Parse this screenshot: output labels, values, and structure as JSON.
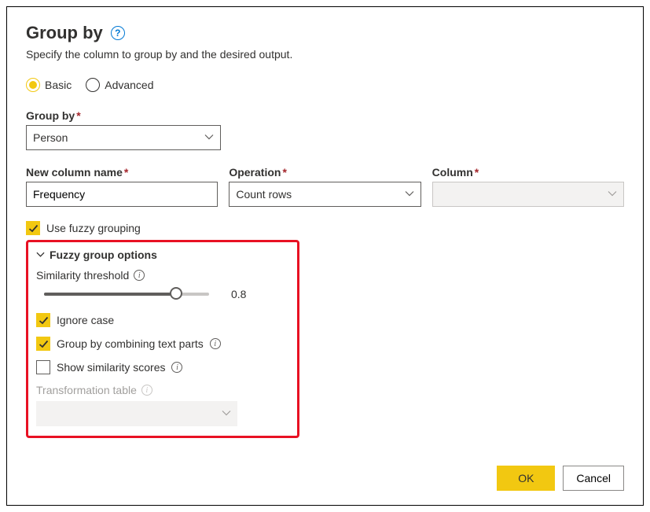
{
  "title": "Group by",
  "subtitle": "Specify the column to group by and the desired output.",
  "mode": {
    "basic": "Basic",
    "advanced": "Advanced"
  },
  "groupByLabel": "Group by",
  "groupByValue": "Person",
  "newColumnLabel": "New column name",
  "newColumnValue": "Frequency",
  "operationLabel": "Operation",
  "operationValue": "Count rows",
  "columnLabel": "Column",
  "useFuzzyLabel": "Use fuzzy grouping",
  "fuzzy": {
    "header": "Fuzzy group options",
    "similarityLabel": "Similarity threshold",
    "similarityValue": "0.8",
    "ignoreCaseLabel": "Ignore case",
    "combineTextLabel": "Group by combining text parts",
    "showScoresLabel": "Show similarity scores",
    "transformLabel": "Transformation table"
  },
  "buttons": {
    "ok": "OK",
    "cancel": "Cancel"
  }
}
